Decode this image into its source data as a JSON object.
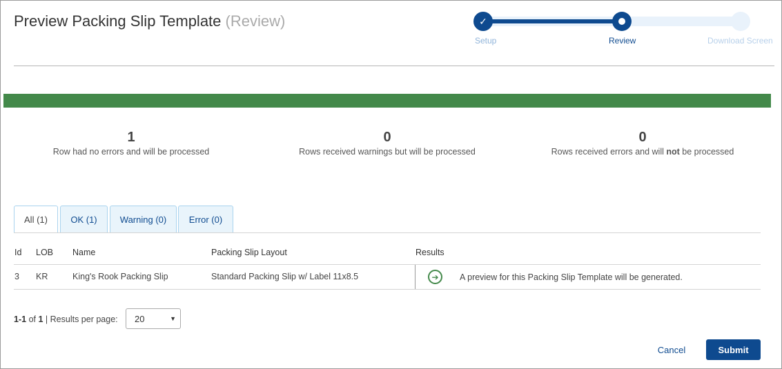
{
  "header": {
    "title": "Preview Packing Slip Template",
    "subtitle": "(Review)"
  },
  "stepper": {
    "steps": [
      {
        "label": "Setup",
        "state": "done"
      },
      {
        "label": "Review",
        "state": "current"
      },
      {
        "label": "Download Screen",
        "state": "future"
      }
    ],
    "done_icon": "check-icon"
  },
  "progress": {
    "percent": 100,
    "color": "#43894a"
  },
  "stats": [
    {
      "number": "1",
      "text": "Row had no errors and will be processed"
    },
    {
      "number": "0",
      "text": "Rows received warnings but will be processed"
    },
    {
      "number": "0",
      "text_before": "Rows received errors and will ",
      "text_bold": "not",
      "text_after": " be processed"
    }
  ],
  "tabs": [
    {
      "label": "All (1)",
      "active": true
    },
    {
      "label": "OK (1)"
    },
    {
      "label": "Warning (0)"
    },
    {
      "label": "Error (0)"
    }
  ],
  "table": {
    "headers": [
      "Id",
      "LOB",
      "Name",
      "Packing Slip Layout",
      "Results"
    ],
    "rows": [
      {
        "id": "3",
        "lob": "KR",
        "name": "King's Rook Packing Slip",
        "layout": "Standard Packing Slip w/ Label 11x8.5",
        "result_icon": "arrow-right-circle-icon",
        "result": "A preview for this Packing Slip Template will be generated."
      }
    ]
  },
  "pager": {
    "range": "1-1",
    "of_label": "of",
    "total": "1",
    "per_page_label": "| Results per page:",
    "per_page": "20"
  },
  "actions": {
    "cancel": "Cancel",
    "submit": "Submit"
  },
  "colors": {
    "primary": "#0e4a8f",
    "success": "#43894a"
  }
}
